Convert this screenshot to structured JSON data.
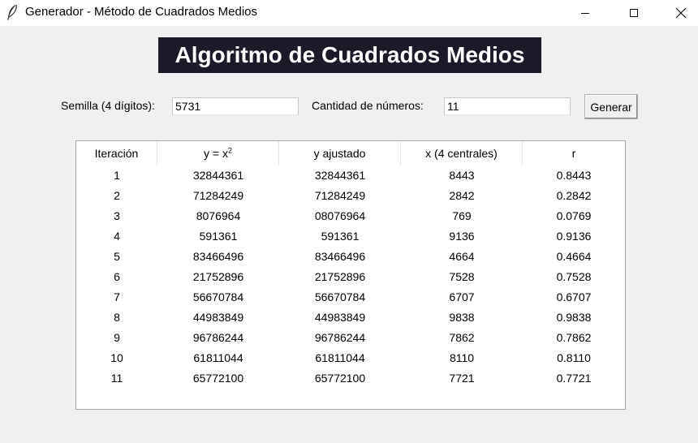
{
  "window": {
    "title": "Generador - Método de Cuadrados Medios",
    "icon": "feather-icon"
  },
  "heading": "Algoritmo de Cuadrados Medios",
  "form": {
    "seed_label": "Semilla (4 dígitos):",
    "seed_value": "5731",
    "quantity_label": "Cantidad de números:",
    "quantity_value": "11",
    "generate_label": "Generar"
  },
  "table": {
    "headers": [
      "Iteración",
      "y = x",
      "y ajustado",
      "x (4 centrales)",
      "r"
    ],
    "header_superscript": "2",
    "rows": [
      [
        "1",
        "32844361",
        "32844361",
        "8443",
        "0.8443"
      ],
      [
        "2",
        "71284249",
        "71284249",
        "2842",
        "0.2842"
      ],
      [
        "3",
        "8076964",
        "08076964",
        "769",
        "0.0769"
      ],
      [
        "4",
        "591361",
        "591361",
        "9136",
        "0.9136"
      ],
      [
        "5",
        "83466496",
        "83466496",
        "4664",
        "0.4664"
      ],
      [
        "6",
        "21752896",
        "21752896",
        "7528",
        "0.7528"
      ],
      [
        "7",
        "56670784",
        "56670784",
        "6707",
        "0.6707"
      ],
      [
        "8",
        "44983849",
        "44983849",
        "9838",
        "0.9838"
      ],
      [
        "9",
        "96786244",
        "96786244",
        "7862",
        "0.7862"
      ],
      [
        "10",
        "61811044",
        "61811044",
        "8110",
        "0.8110"
      ],
      [
        "11",
        "65772100",
        "65772100",
        "7721",
        "0.7721"
      ]
    ]
  }
}
